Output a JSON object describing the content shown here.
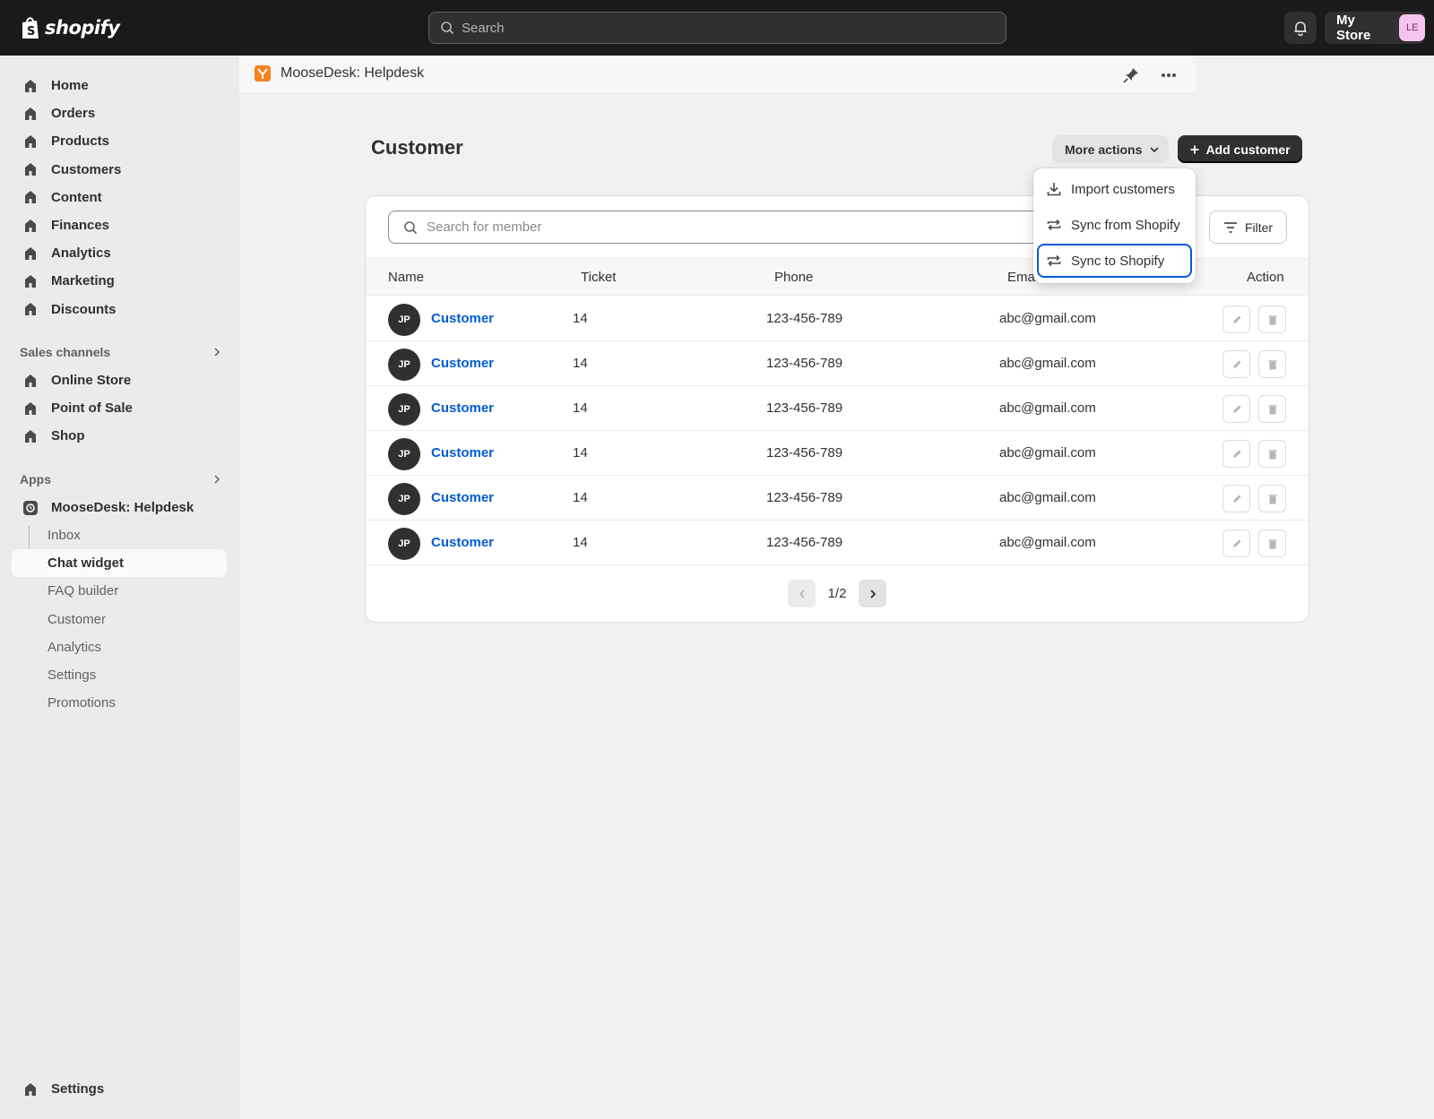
{
  "topbar": {
    "logo_text": "shopify",
    "search_placeholder": "Search",
    "store_name": "My Store",
    "store_initials": "LE"
  },
  "sidebar": {
    "main_items": [
      {
        "label": "Home",
        "icon": "home-icon"
      },
      {
        "label": "Orders",
        "icon": "orders-icon"
      },
      {
        "label": "Products",
        "icon": "products-icon"
      },
      {
        "label": "Customers",
        "icon": "customers-icon"
      },
      {
        "label": "Content",
        "icon": "content-icon"
      },
      {
        "label": "Finances",
        "icon": "finances-icon"
      },
      {
        "label": "Analytics",
        "icon": "analytics-icon"
      },
      {
        "label": "Marketing",
        "icon": "marketing-icon"
      },
      {
        "label": "Discounts",
        "icon": "discounts-icon"
      }
    ],
    "sales_channels_label": "Sales channels",
    "sales_channels": [
      {
        "label": "Online Store"
      },
      {
        "label": "Point of Sale"
      },
      {
        "label": "Shop"
      }
    ],
    "apps_label": "Apps",
    "app_name": "MooseDesk: Helpdesk",
    "app_sub_items": [
      {
        "label": "Inbox"
      },
      {
        "label": "Chat widget"
      },
      {
        "label": "FAQ builder"
      },
      {
        "label": "Customer"
      },
      {
        "label": "Analytics"
      },
      {
        "label": "Settings"
      },
      {
        "label": "Promotions"
      }
    ],
    "active_sub_item": "Chat widget",
    "settings_label": "Settings"
  },
  "appbar": {
    "title": "MooseDesk: Helpdesk"
  },
  "page": {
    "title": "Customer",
    "more_actions_label": "More actions",
    "add_customer_label": "Add customer",
    "search_placeholder": "Search for member",
    "filter_label": "Filter"
  },
  "menu": {
    "items": [
      {
        "label": "Import customers",
        "icon": "import-icon"
      },
      {
        "label": "Sync from Shopify",
        "icon": "sync-icon"
      },
      {
        "label": "Sync to Shopify",
        "icon": "sync-icon"
      }
    ],
    "focused": "Sync to Shopify"
  },
  "table": {
    "columns": [
      "Name",
      "Ticket",
      "Phone",
      "Email",
      "Action"
    ],
    "rows": [
      {
        "initials": "JP",
        "name": "Customer",
        "ticket": "14",
        "phone": "123-456-789",
        "email": "abc@gmail.com"
      },
      {
        "initials": "JP",
        "name": "Customer",
        "ticket": "14",
        "phone": "123-456-789",
        "email": "abc@gmail.com"
      },
      {
        "initials": "JP",
        "name": "Customer",
        "ticket": "14",
        "phone": "123-456-789",
        "email": "abc@gmail.com"
      },
      {
        "initials": "JP",
        "name": "Customer",
        "ticket": "14",
        "phone": "123-456-789",
        "email": "abc@gmail.com"
      },
      {
        "initials": "JP",
        "name": "Customer",
        "ticket": "14",
        "phone": "123-456-789",
        "email": "abc@gmail.com"
      },
      {
        "initials": "JP",
        "name": "Customer",
        "ticket": "14",
        "phone": "123-456-789",
        "email": "abc@gmail.com"
      }
    ]
  },
  "pagination": {
    "label": "1/2"
  },
  "colors": {
    "topbar": "#1a1a1a",
    "link": "#005bd3",
    "focus": "#005bd3",
    "primary_button": "#303030",
    "app_icon": "#f5821f"
  }
}
